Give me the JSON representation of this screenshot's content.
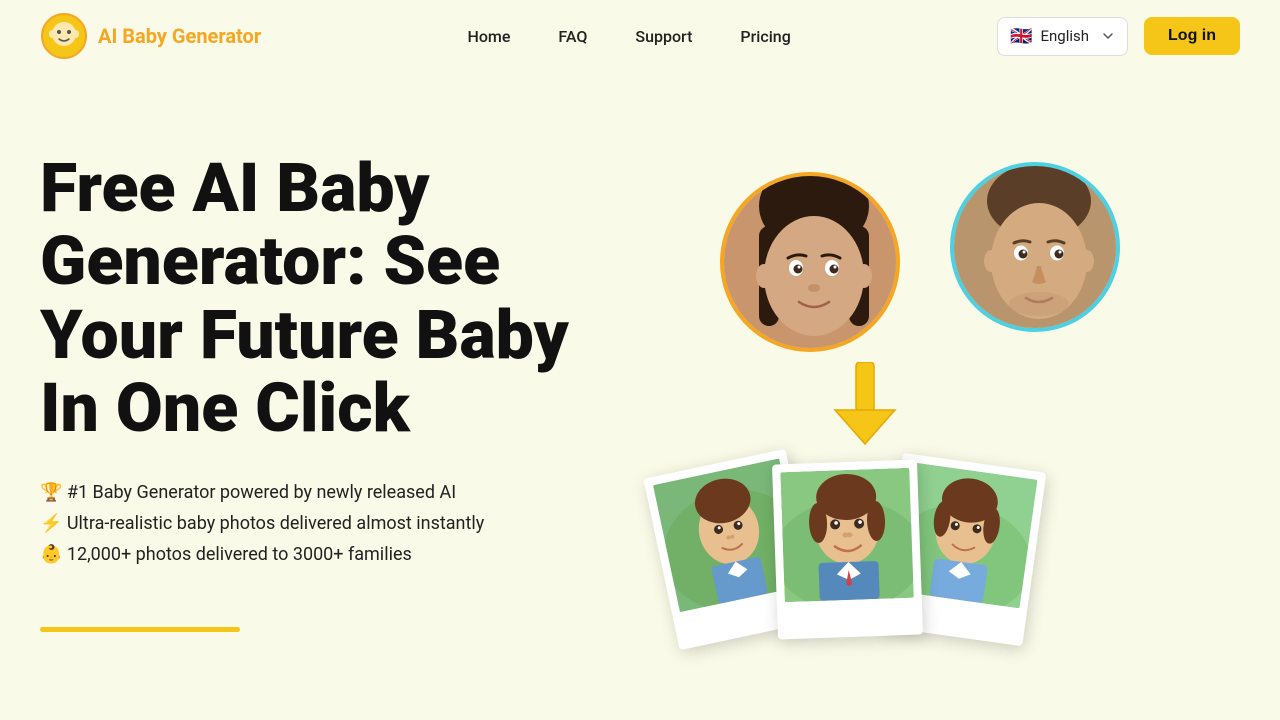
{
  "header": {
    "logo_text": "AI Baby Generator",
    "nav": {
      "home": "Home",
      "faq": "FAQ",
      "support": "Support",
      "pricing": "Pricing"
    },
    "language": "English",
    "login_label": "Log in"
  },
  "hero": {
    "title": "Free AI Baby Generator: See Your Future Baby In One Click",
    "features": [
      "🏆 #1 Baby Generator powered by newly released AI",
      "⚡ Ultra-realistic baby photos delivered almost instantly",
      "👶 12,000+ photos delivered to 3000+ families"
    ]
  }
}
